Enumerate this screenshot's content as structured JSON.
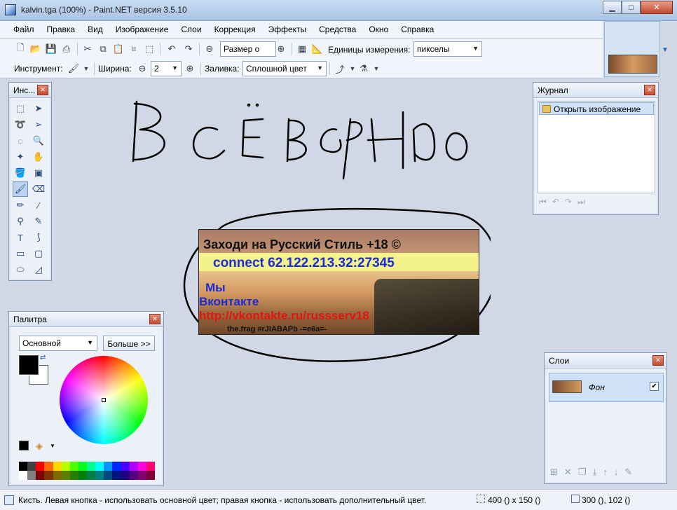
{
  "window": {
    "title": "kalvin.tga (100%) - Paint.NET версия 3.5.10",
    "minimize_label": "▁",
    "maximize_label": "□",
    "close_label": "✕"
  },
  "menu": [
    "Файл",
    "Правка",
    "Вид",
    "Изображение",
    "Слои",
    "Коррекция",
    "Эффекты",
    "Средства",
    "Окно",
    "Справка"
  ],
  "toolbar1": {
    "zoom_select": "Размер о",
    "units_label": "Единицы измерения:",
    "units_select": "пикселы"
  },
  "toolbar2": {
    "tool_label": "Инструмент:",
    "width_label": "Ширина:",
    "width_value": "2",
    "fill_label": "Заливка:",
    "fill_select": "Сплошной цвет"
  },
  "tools_panel": {
    "title": "Инс..."
  },
  "journal_panel": {
    "title": "Журнал",
    "items": [
      "Открыть изображение"
    ]
  },
  "palette_panel": {
    "title": "Палитра",
    "palette_select": "Основной",
    "more_button": "Больше >>",
    "primary_color": "#000000",
    "secondary_color": "#ffffff",
    "swatch_colors_row1": [
      "#000000",
      "#404040",
      "#ff0000",
      "#ff6a00",
      "#ffd800",
      "#b6ff00",
      "#4cff00",
      "#00ff21",
      "#00ff90",
      "#00ffff",
      "#0094ff",
      "#0026ff",
      "#4800ff",
      "#b200ff",
      "#ff00dc",
      "#ff006e"
    ],
    "swatch_colors_row2": [
      "#ffffff",
      "#808080",
      "#7f0000",
      "#7f3300",
      "#7f6a00",
      "#5b7f00",
      "#267f00",
      "#007f0e",
      "#007f46",
      "#007f7f",
      "#004a7f",
      "#00137f",
      "#21007f",
      "#57007f",
      "#7f006e",
      "#7f0037"
    ]
  },
  "layers_panel": {
    "title": "Слои",
    "layers": [
      {
        "name": "Фон",
        "visible": true
      }
    ]
  },
  "canvas": {
    "handwriting": "ВСЁ ВЕРНО",
    "banner": {
      "line1": "Заходи на Русский Стиль +18 ©",
      "line2": "connect 62.122.213.32:27345",
      "line3": "Мы",
      "line4": "Вконтакте",
      "line5": "http://vkontakte.ru/russserv18",
      "line6": "the.frag #rJIABAPb -=e6a=-"
    }
  },
  "statusbar": {
    "hint": "Кисть. Левая кнопка - использовать основной цвет; правая кнопка - использовать дополнительный цвет.",
    "image_size": "400 () x 150 ()",
    "cursor_position": "300 (), 102 ()"
  }
}
